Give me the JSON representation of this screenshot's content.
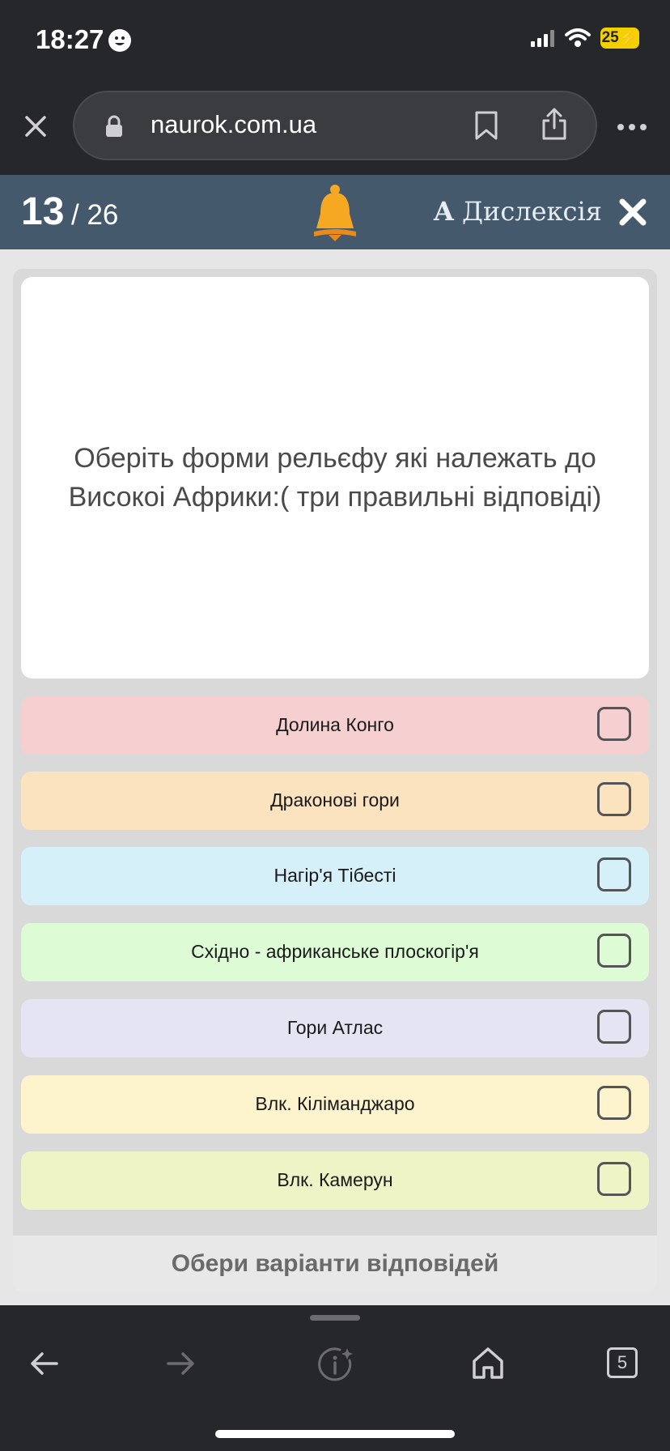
{
  "status": {
    "time": "18:27",
    "battery": "25"
  },
  "browser": {
    "url": "naurok.com.ua"
  },
  "quiz": {
    "current": "13",
    "total": "/ 26",
    "dyslexia_label": "Дислексія",
    "question": "Оберіть форми рельєфу які належать до Високоі Африки:( три правильні відповіді)",
    "options": [
      {
        "label": "Долина Конго",
        "color": "#f6d0d0"
      },
      {
        "label": "Драконові гори",
        "color": "#fbe3c0"
      },
      {
        "label": "Нагір'я Тібесті",
        "color": "#d6f0fa"
      },
      {
        "label": "Східно - африканське плоскогір'я",
        "color": "#ddfcd6"
      },
      {
        "label": "Гори Атлас",
        "color": "#e4e4f3"
      },
      {
        "label": "Влк. Кіліманджаро",
        "color": "#fdf3cd"
      },
      {
        "label": "Влк. Камерун",
        "color": "#eff4c7"
      }
    ],
    "submit_label": "Обери варіанти відповідей"
  },
  "bottom_nav": {
    "tabs_count": "5"
  },
  "colors": {
    "header_bg": "#44596c",
    "bell": "#f7a823",
    "dark_chrome": "#26272b"
  }
}
